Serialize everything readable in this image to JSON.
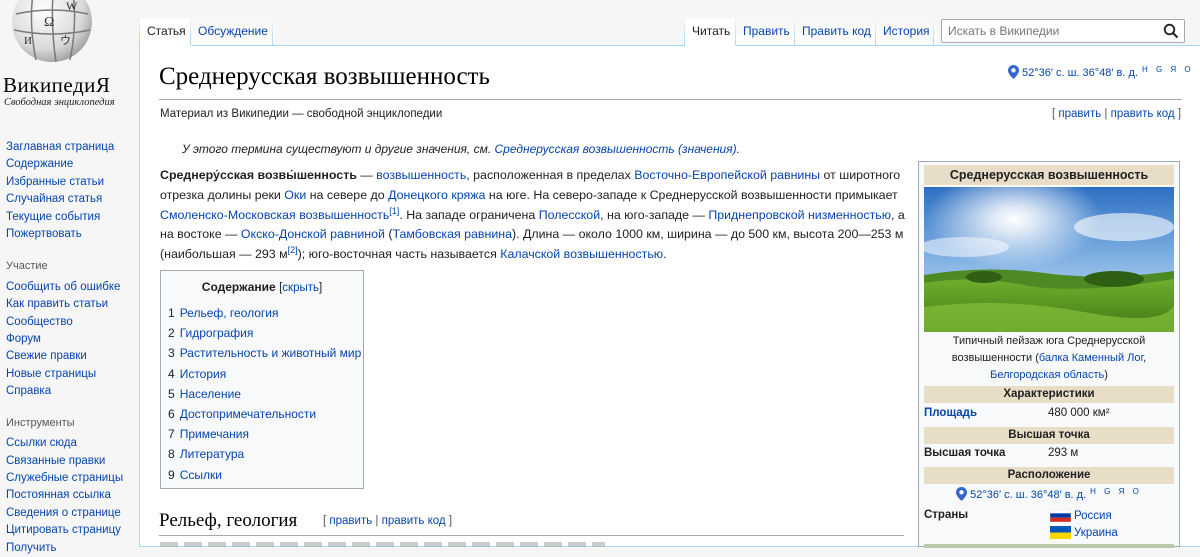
{
  "logo": {
    "wordmark": "ВикипедиЯ",
    "tagline": "Свободная энциклопедия"
  },
  "sidebar": {
    "nav": [
      "Заглавная страница",
      "Содержание",
      "Избранные статьи",
      "Случайная статья",
      "Текущие события",
      "Пожертвовать"
    ],
    "participation_heading": "Участие",
    "participation": [
      "Сообщить об ошибке",
      "Как править статьи",
      "Сообщество",
      "Форум",
      "Свежие правки",
      "Новые страницы",
      "Справка"
    ],
    "tools_heading": "Инструменты",
    "tools": [
      "Ссылки сюда",
      "Связанные правки",
      "Служебные страницы",
      "Постоянная ссылка",
      "Сведения о странице",
      "Цитировать страницу",
      "Получить"
    ]
  },
  "tabs": {
    "article": "Статья",
    "talk": "Обсуждение",
    "read": "Читать",
    "edit": "Править",
    "edit_source": "Править код",
    "history": "История"
  },
  "search": {
    "placeholder": "Искать в Википедии"
  },
  "page": {
    "title": "Среднерусская возвышенность",
    "coords": "52°36′ с. ш. 36°48′ в. д.",
    "geo_links": "H G Я O",
    "tagline": "Материал из Википедии — свободной энциклопедии",
    "edit_links": {
      "open": "[ ",
      "edit": "править",
      "sep": " | ",
      "edit_source": "править код",
      "close": " ]"
    },
    "hatnote_text": "У этого термина существуют и другие значения, см. ",
    "hatnote_link": "Среднерусская возвышенность (значения)",
    "hatnote_end": ".",
    "lead": {
      "bold": "Среднеру́сская возвы́шенность",
      "t1": " — ",
      "l1": "возвышенность",
      "t2": ", расположенная в пределах ",
      "l2": "Восточно-Европейской равнины",
      "t3": " от широтного отрезка долины реки ",
      "l3": "Оки",
      "t4": " на севере до ",
      "l4": "Донецкого кряжа",
      "t5": " на юге. На северо-западе к Среднерусской возвышенности примыкает ",
      "l5": "Смоленско-Московская возвышенность",
      "ref1": "[1]",
      "t6": ". На западе ограничена ",
      "l6": "Полесской",
      "t7": ", на юго-западе — ",
      "l7": "Приднепровской низменностью",
      "t8": ", а на востоке — ",
      "l8": "Окско-Донской равниной",
      "t9": " (",
      "l9": "Тамбовская равнина",
      "t10": "). Длина — около 1000 км, ширина — до 500 км, высота 200—253 м (наибольшая — 293 м",
      "ref2": "[2]",
      "t11": "); юго-восточная часть называется ",
      "l10": "Калачской возвышенностью",
      "t12": "."
    }
  },
  "toc": {
    "title": "Содержание",
    "hide": "скрыть",
    "items": [
      {
        "num": "1",
        "label": "Рельеф, геология"
      },
      {
        "num": "2",
        "label": "Гидрография"
      },
      {
        "num": "3",
        "label": "Растительность и животный мир"
      },
      {
        "num": "4",
        "label": "История"
      },
      {
        "num": "5",
        "label": "Население"
      },
      {
        "num": "6",
        "label": "Достопримечательности"
      },
      {
        "num": "7",
        "label": "Примечания"
      },
      {
        "num": "8",
        "label": "Литература"
      },
      {
        "num": "9",
        "label": "Ссылки"
      }
    ]
  },
  "section1": {
    "title": "Рельеф, геология"
  },
  "infobox": {
    "title": "Среднерусская возвышенность",
    "caption_text": "Типичный пейзаж юга Среднерусской возвышенности (",
    "caption_link1": "балка Каменный Лог",
    "caption_sep": ", ",
    "caption_link2": "Белгородская область",
    "caption_end": ")",
    "characteristics_heading": "Характеристики",
    "area_label": "Площадь",
    "area_value": "480 000 км²",
    "highest_heading": "Высшая точка",
    "highest_label": "Высшая точка",
    "highest_value": "293 м",
    "location_heading": "Расположение",
    "coords": "52°36′ с. ш. 36°48′ в. д.",
    "geo_links": "H G Я O",
    "countries_label": "Страны",
    "countries": [
      "Россия",
      "Украина"
    ]
  },
  "colors": {
    "link": "#0645ad",
    "visited": "#0b0080",
    "infobox_header": "#e8ddc6",
    "border": "#a7d7f9"
  }
}
